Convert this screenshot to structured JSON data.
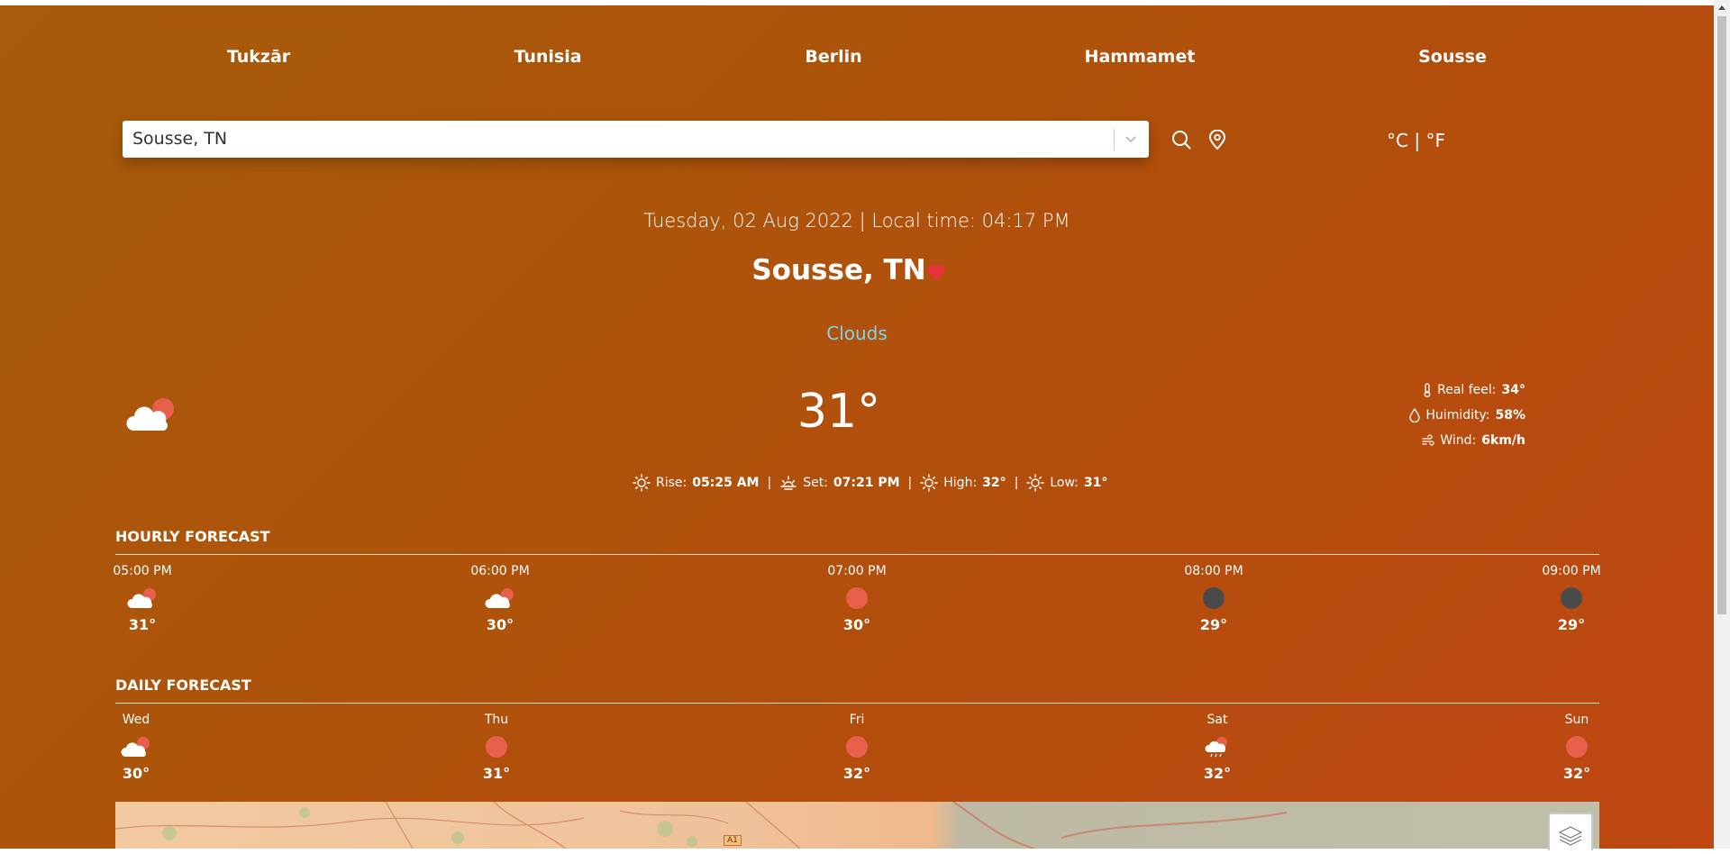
{
  "nav": {
    "links": [
      "Tukzār",
      "Tunisia",
      "Berlin",
      "Hammamet",
      "Sousse"
    ]
  },
  "search": {
    "value": "Sousse, TN"
  },
  "units": {
    "celsius": "°C",
    "separator": "|",
    "fahrenheit": "°F"
  },
  "current": {
    "datetime": "Tuesday, 02 Aug 2022 | Local time: 04:17 PM",
    "city": "Sousse, TN",
    "condition": "Clouds",
    "temp": "31°",
    "icon": "cloud-sun-icon",
    "details": {
      "real_feel_label": "Real feel:",
      "real_feel": "34°",
      "humidity_label": "Huimidity:",
      "humidity": "58%",
      "wind_label": "Wind:",
      "wind": "6km/h"
    },
    "sun": {
      "rise_label": "Rise:",
      "rise": "05:25 AM",
      "set_label": "Set:",
      "set": "07:21 PM",
      "high_label": "High:",
      "high": "32°",
      "low_label": "Low:",
      "low": "31°"
    }
  },
  "hourly": {
    "title": "Hourly Forecast",
    "items": [
      {
        "label": "05:00 PM",
        "temp": "31°",
        "icon": "cloud-sun-icon"
      },
      {
        "label": "06:00 PM",
        "temp": "30°",
        "icon": "cloud-sun-icon"
      },
      {
        "label": "07:00 PM",
        "temp": "30°",
        "icon": "sun-icon"
      },
      {
        "label": "08:00 PM",
        "temp": "29°",
        "icon": "moon-icon"
      },
      {
        "label": "09:00 PM",
        "temp": "29°",
        "icon": "moon-icon"
      }
    ]
  },
  "daily": {
    "title": "Daily Forecast",
    "items": [
      {
        "label": "Wed",
        "temp": "30°",
        "icon": "cloud-sun-icon"
      },
      {
        "label": "Thu",
        "temp": "31°",
        "icon": "sun-icon"
      },
      {
        "label": "Fri",
        "temp": "32°",
        "icon": "sun-icon"
      },
      {
        "label": "Sat",
        "temp": "32°",
        "icon": "cloud-rain-sun-icon"
      },
      {
        "label": "Sun",
        "temp": "32°",
        "icon": "sun-icon"
      }
    ]
  },
  "map": {
    "road_label": "A1"
  },
  "colors": {
    "accent_sun": "#e8604c",
    "heart": "#e8323c",
    "condition": "#7fd4e8",
    "moon": "#4a4a4a"
  }
}
